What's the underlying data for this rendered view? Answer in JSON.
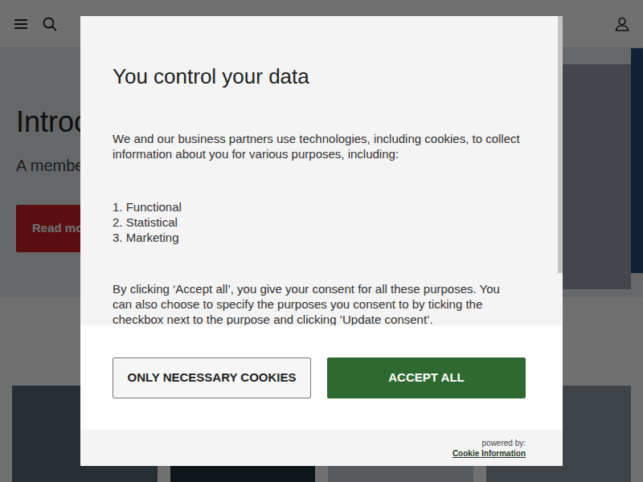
{
  "hero": {
    "title": "Introc",
    "subtitle": "A membe",
    "button": "Read mo"
  },
  "consent": {
    "title": "You control your data",
    "intro": "We and our business partners use technologies, including cookies, to collect information about you for various purposes, including:",
    "purposes": [
      "1. Functional",
      "2. Statistical",
      "3. Marketing"
    ],
    "details": "By clicking ‘Accept all’, you give your consent for all these purposes. You can also choose to specify the purposes you consent to by ticking the checkbox next to the purpose and clicking ‘Update consent’.",
    "buttons": [
      "ONLY NECESSARY COOKIES",
      "ACCEPT ALL"
    ],
    "powered_by": "powered by:",
    "provider": "Cookie Information"
  }
}
